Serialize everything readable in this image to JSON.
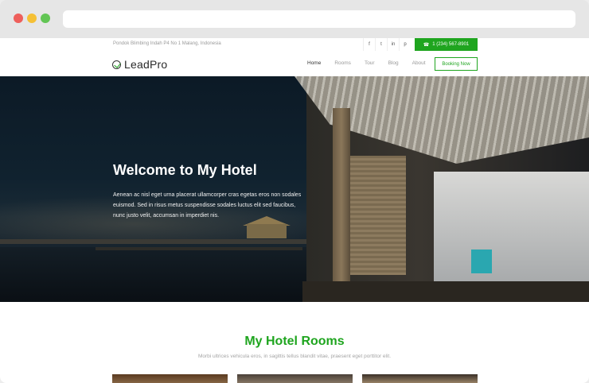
{
  "topbar": {
    "address": "Pondok Blimbing Indah P4 No 1 Malang, Indonesia",
    "social_icons": [
      "facebook-icon",
      "twitter-icon",
      "linkedin-icon",
      "pinterest-icon"
    ],
    "social_glyphs": [
      "f",
      "t",
      "in",
      "p"
    ],
    "phone_icon": "☎",
    "phone": "1 (234) 567-8901"
  },
  "nav": {
    "logo_text": "LeadPro",
    "items": [
      {
        "label": "Home",
        "active": true
      },
      {
        "label": "Rooms",
        "active": false
      },
      {
        "label": "Tour",
        "active": false
      },
      {
        "label": "Blog",
        "active": false
      },
      {
        "label": "About",
        "active": false
      }
    ],
    "booking_label": "Booking Now"
  },
  "hero": {
    "title": "Welcome to My Hotel",
    "text": "Aenean ac nisl eget urna placerat ullamcorper cras egetas eros non sodales euismod. Sed in risus metus suspendisse sodales luctus elit sed faucibus, nunc justo velit, accumsan in imperdiet nis."
  },
  "rooms": {
    "title": "My Hotel Rooms",
    "subtitle": "Morbi ultrices vehicula eros, in sagittis tellus blandit vitae, praesent eget porttitor elit."
  },
  "colors": {
    "accent": "#1fa51f"
  }
}
